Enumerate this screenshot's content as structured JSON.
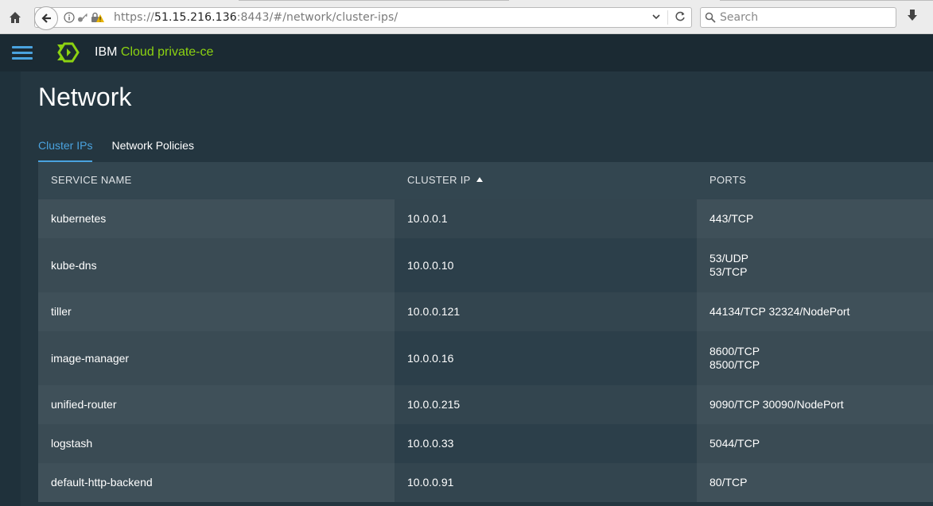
{
  "browser": {
    "url_scheme": "https://",
    "url_host": "51.15.216.136",
    "url_rest": ":8443/#/network/cluster-ips/",
    "search_placeholder": "Search"
  },
  "header": {
    "brand_prefix": "IBM",
    "brand_accent": "Cloud private-ce",
    "accent_color": "#8cd211",
    "menu_color": "#4aa3df"
  },
  "page": {
    "title": "Network",
    "tabs": [
      {
        "label": "Cluster IPs",
        "active": true
      },
      {
        "label": "Network Policies",
        "active": false
      }
    ]
  },
  "table": {
    "columns": [
      "SERVICE NAME",
      "CLUSTER IP",
      "PORTS"
    ],
    "sorted_column": "CLUSTER IP",
    "sort_direction": "ascending",
    "rows": [
      {
        "name": "kubernetes",
        "ip": "10.0.0.1",
        "ports": [
          "443/TCP"
        ]
      },
      {
        "name": "kube-dns",
        "ip": "10.0.0.10",
        "ports": [
          "53/UDP",
          "53/TCP"
        ]
      },
      {
        "name": "tiller",
        "ip": "10.0.0.121",
        "ports": [
          "44134/TCP 32324/NodePort"
        ]
      },
      {
        "name": "image-manager",
        "ip": "10.0.0.16",
        "ports": [
          "8600/TCP",
          "8500/TCP"
        ]
      },
      {
        "name": "unified-router",
        "ip": "10.0.0.215",
        "ports": [
          "9090/TCP 30090/NodePort"
        ]
      },
      {
        "name": "logstash",
        "ip": "10.0.0.33",
        "ports": [
          "5044/TCP"
        ]
      },
      {
        "name": "default-http-backend",
        "ip": "10.0.0.91",
        "ports": [
          "80/TCP"
        ]
      }
    ]
  }
}
